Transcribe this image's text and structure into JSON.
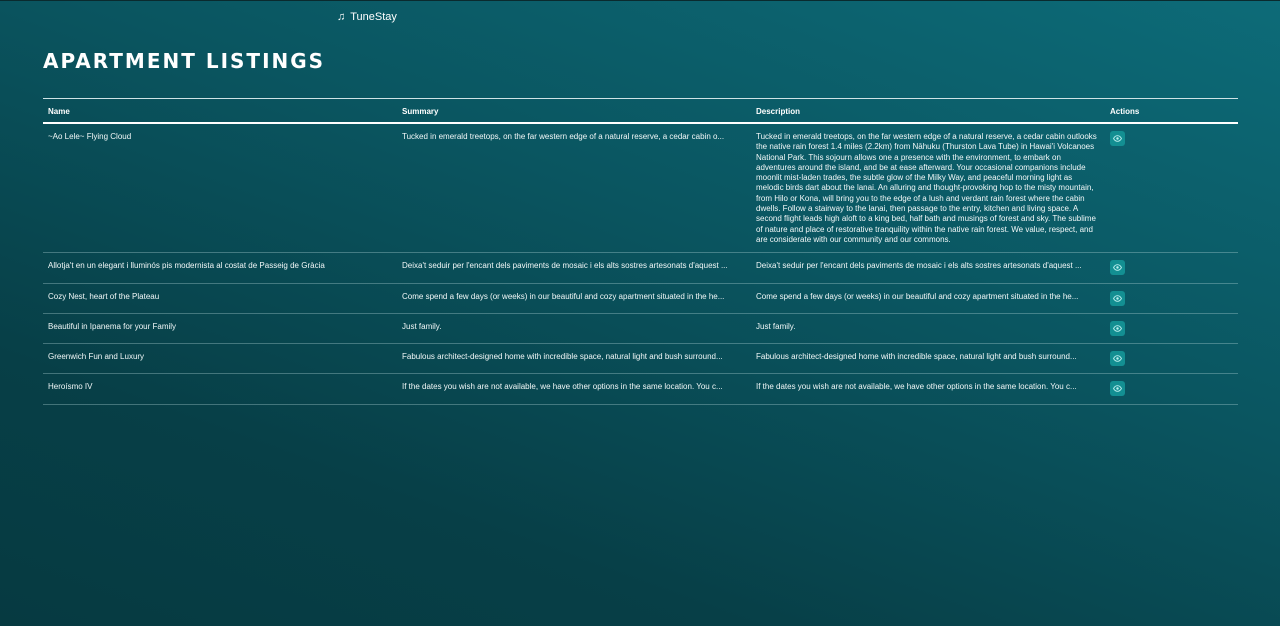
{
  "app": {
    "brand_name": "TuneStay",
    "brand_icon": "music-note-icon"
  },
  "page": {
    "title": "APARTMENT LISTINGS"
  },
  "table": {
    "headers": {
      "name": "Name",
      "summary": "Summary",
      "description": "Description",
      "actions": "Actions"
    },
    "action_icon": "eye-icon",
    "rows": [
      {
        "name": "~Ao Lele~ Flying Cloud",
        "summary": "Tucked in emerald treetops, on the far western edge of a natural reserve, a cedar cabin o...",
        "description": "Tucked in emerald treetops, on the far western edge of a natural reserve, a cedar cabin outlooks the native rain forest 1.4 miles (2.2km) from Nāhuku (Thurston Lava Tube) in Hawai'i Volcanoes National Park. This sojourn allows one a presence with the environment, to embark on adventures around the island, and be at ease afterward. Your occasional companions include moonlit mist-laden trades, the subtle glow of the Milky Way, and peaceful morning light as melodic birds dart about the lanai. An alluring and thought-provoking hop to the misty mountain, from Hilo or Kona, will bring you to the edge of a lush and verdant rain forest where the cabin dwells. Follow a stairway to the lanai, then passage to the entry, kitchen and living space. A second flight leads high aloft to a king bed, half bath and musings of forest and sky. The sublime of nature and place of restorative tranquility within the native rain forest. We value, respect, and are considerate with our community and our commons."
      },
      {
        "name": "Allotja't en un elegant i lluminós pis modernista al costat de Passeig de Gràcia",
        "summary": "Deixa't seduir per l'encant dels paviments de mosaic i els alts sostres artesonats d'aquest ...",
        "description": "Deixa't seduir per l'encant dels paviments de mosaic i els alts sostres artesonats d'aquest ..."
      },
      {
        "name": "Cozy Nest, heart of the Plateau",
        "summary": "Come spend a few days (or weeks) in our beautiful and cozy apartment situated in the he...",
        "description": "Come spend a few days (or weeks) in our beautiful and cozy apartment situated in the he..."
      },
      {
        "name": "Beautiful in Ipanema for your Family",
        "summary": "Just family.",
        "description": "Just family."
      },
      {
        "name": "Greenwich Fun and Luxury",
        "summary": "Fabulous architect-designed home with incredible space, natural light and bush surround...",
        "description": "Fabulous architect-designed home with incredible space, natural light and bush surround..."
      },
      {
        "name": "Heroísmo IV",
        "summary": "If the dates you wish are not available, we have other options in the same location. You c...",
        "description": "If the dates you wish are not available, we have other options in the same location. You c..."
      }
    ]
  }
}
